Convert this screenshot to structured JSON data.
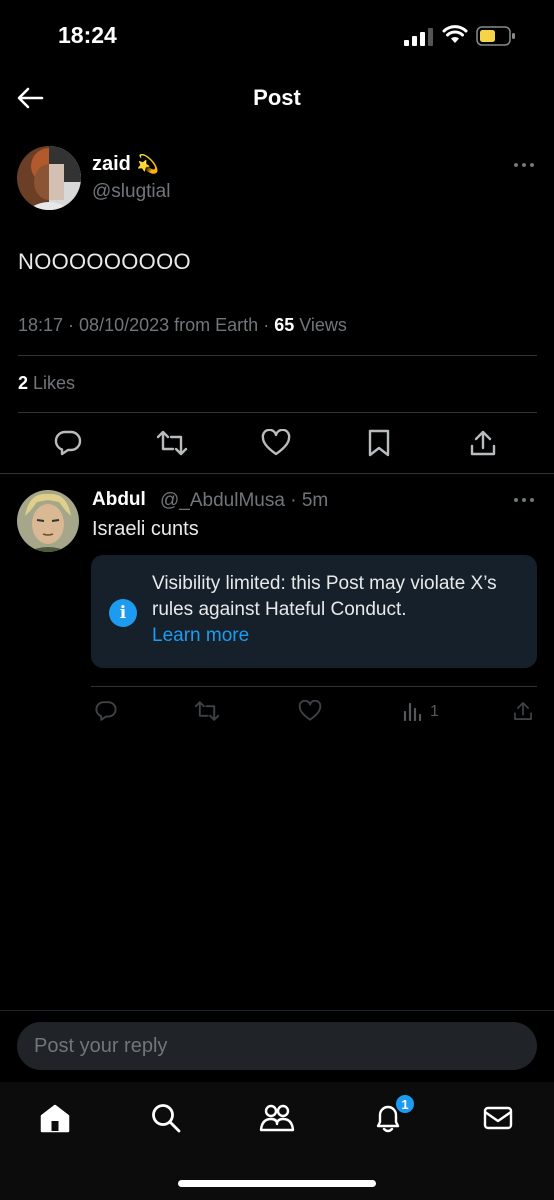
{
  "status_bar": {
    "time": "18:24"
  },
  "header": {
    "title": "Post"
  },
  "post": {
    "author_name": "zaid",
    "author_emoji": "💫",
    "author_handle": "@slugtial",
    "text": "NOOOOOOOOO",
    "time": "18:17",
    "date": "08/10/2023",
    "source": "from Earth",
    "views_count": "65",
    "views_label": "Views",
    "likes_count": "2",
    "likes_label": "Likes"
  },
  "reply": {
    "author_name": "Abdul",
    "author_handle": "@_AbdulMusa",
    "age": "5m",
    "text": "Israeli cunts",
    "notice_text": "Visibility limited: this Post may violate X’s rules against Hateful Conduct.",
    "notice_link": "Learn more",
    "views_count": "1"
  },
  "composer": {
    "placeholder": "Post your reply"
  },
  "tabs": {
    "notifications_badge": "1"
  },
  "colors": {
    "accent": "#1d9bf0",
    "background": "#000000",
    "muted": "#71767b"
  },
  "icons": [
    "back-arrow-icon",
    "more-icon",
    "reply-icon",
    "repost-icon",
    "like-icon",
    "bookmark-icon",
    "share-icon",
    "info-icon",
    "views-icon",
    "home-icon",
    "search-icon",
    "communities-icon",
    "notifications-icon",
    "messages-icon"
  ]
}
